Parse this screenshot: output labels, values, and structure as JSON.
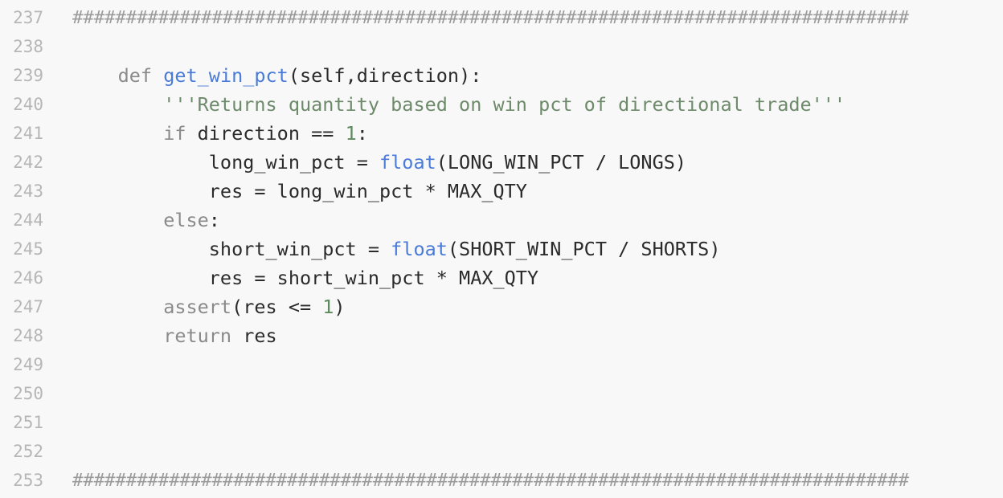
{
  "editor": {
    "line_numbers": [
      "237",
      "238",
      "239",
      "240",
      "241",
      "242",
      "243",
      "244",
      "245",
      "246",
      "247",
      "248",
      "249",
      "250",
      "251",
      "252",
      "253"
    ],
    "lines": {
      "l237": {
        "hashes": "##############################################################################"
      },
      "l239": {
        "indent": "    ",
        "kw": "def",
        "sp": " ",
        "fn": "get_win_pct",
        "rest": "(self,direction):"
      },
      "l240": {
        "indent": "        ",
        "str": "'''Returns quantity based on win pct of directional trade'''"
      },
      "l241": {
        "indent": "        ",
        "kw": "if",
        "rest_a": " direction == ",
        "num": "1",
        "rest_b": ":"
      },
      "l242": {
        "indent": "            ",
        "a": "long_win_pct = ",
        "builtin": "float",
        "b": "(LONG_WIN_PCT / LONGS)"
      },
      "l243": {
        "indent": "            ",
        "a": "res = long_win_pct * MAX_QTY"
      },
      "l244": {
        "indent": "        ",
        "kw": "else",
        "a": ":"
      },
      "l245": {
        "indent": "            ",
        "a": "short_win_pct = ",
        "builtin": "float",
        "b": "(SHORT_WIN_PCT / SHORTS)"
      },
      "l246": {
        "indent": "            ",
        "a": "res = short_win_pct * MAX_QTY"
      },
      "l247": {
        "indent": "        ",
        "kw": "assert",
        "a": "(res <= ",
        "num": "1",
        "b": ")"
      },
      "l248": {
        "indent": "        ",
        "kw": "return",
        "a": " res"
      },
      "l253": {
        "hashes": "##############################################################################"
      }
    }
  },
  "colors": {
    "background": "#f8f8f8",
    "line_number": "#b6b6b6",
    "keyword": "#8a8a8a",
    "function": "#4a7bd8",
    "string": "#6d8a6a",
    "number": "#5f8a5f",
    "text": "#2b2b2b"
  }
}
